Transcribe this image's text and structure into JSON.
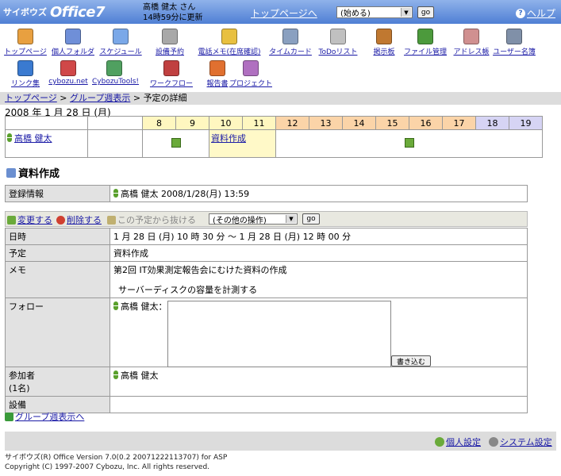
{
  "header": {
    "logo_brand": "サイボウズ",
    "logo_product": "Office7",
    "user_name": "高橋 健太 さん",
    "update_time": "14時59分に更新",
    "top_link": "トップページへ",
    "quick_select": "(始める)",
    "go_label": "go",
    "help": "ヘルプ"
  },
  "apps": [
    {
      "label": "トップページ",
      "icon": "home-icon",
      "color": "#e8a040"
    },
    {
      "label": "個人フォルダ",
      "icon": "folder-icon",
      "color": "#6f8fd8"
    },
    {
      "label": "スケジュール",
      "icon": "schedule-icon",
      "color": "#7aa8e8"
    },
    {
      "label": "設備予約",
      "icon": "facility-icon",
      "color": "#a8a8a8"
    },
    {
      "label": "電話メモ(在席確認)",
      "icon": "phone-memo-icon",
      "color": "#e8c040"
    },
    {
      "label": "タイムカード",
      "icon": "timecard-icon",
      "color": "#8aa0c0"
    },
    {
      "label": "ToDoリスト",
      "icon": "todo-icon",
      "color": "#c0c0c0"
    },
    {
      "label": "掲示板",
      "icon": "bulletin-icon",
      "color": "#c07830"
    },
    {
      "label": "ファイル管理",
      "icon": "file-management-icon",
      "color": "#4c9a3c"
    },
    {
      "label": "アドレス帳",
      "icon": "address-book-icon",
      "color": "#d09090"
    },
    {
      "label": "ユーザー名簿",
      "icon": "user-directory-icon",
      "color": "#8090a8"
    },
    {
      "label": "リンク集",
      "icon": "links-icon",
      "color": "#3a7ad0"
    },
    {
      "label": "cybozu.net",
      "icon": "cybozu-net-icon",
      "color": "#d04848"
    },
    {
      "label": "CybozuTools!",
      "icon": "cybozu-tools-icon",
      "color": "#50a060"
    },
    {
      "label": "ワークフロー",
      "icon": "workflow-icon",
      "color": "#c04040"
    },
    {
      "label": "報告書",
      "icon": "report-icon",
      "color": "#e07030"
    },
    {
      "label": "プロジェクト",
      "icon": "project-icon",
      "color": "#b070c0"
    }
  ],
  "breadcrumb": {
    "top": "トップページ",
    "group": "グループ週表示",
    "current": "予定の詳細"
  },
  "date_heading": "2008 年 1 月 28 日 (月)",
  "timeline": {
    "hours": [
      "8",
      "9",
      "10",
      "11",
      "12",
      "13",
      "14",
      "15",
      "16",
      "17",
      "18",
      "19"
    ],
    "person": "高橋 健太",
    "event": "資料作成"
  },
  "section_title": "資料作成",
  "registration": {
    "label": "登録情報",
    "value": "高橋 健太 2008/1/28(月) 13:59"
  },
  "actions": {
    "edit": "変更する",
    "delete": "削除する",
    "leave": "この予定から抜ける",
    "other_select": "(その他の操作)",
    "go": "go"
  },
  "details": {
    "datetime_label": "日時",
    "datetime_value": "1 月 28 日 (月) 10 時 30 分 ～ 1 月 28 日 (月) 12 時 00 分",
    "plan_label": "予定",
    "plan_value": "資料作成",
    "memo_label": "メモ",
    "memo_line1": "第2回 IT効果測定報告会にむけた資料の作成",
    "memo_line2": "サーバーディスクの容量を計測する",
    "follow_label": "フォロー",
    "follow_user": "高橋 健太：",
    "follow_button": "書き込む",
    "participants_label": "参加者",
    "participants_count": "(1名)",
    "participants_value": "高橋 健太",
    "facility_label": "設備"
  },
  "back_link": "グループ週表示へ",
  "footer": {
    "personal_settings": "個人設定",
    "system_settings": "システム設定",
    "copyright_line1": "サイボウズ(R) Office Version 7.0(0.2 20071222113707) for ASP",
    "copyright_line2": "Copyright (C) 1997-2007 Cybozu, Inc. All rights reserved."
  }
}
